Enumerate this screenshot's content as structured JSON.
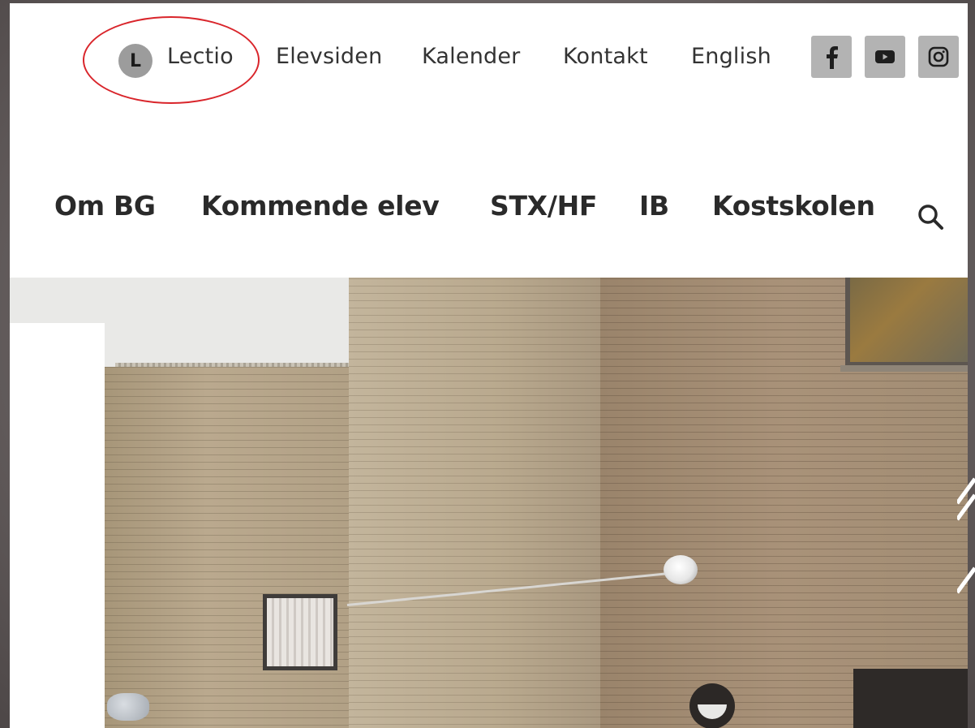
{
  "topbar": {
    "lectio_badge": "L",
    "links": {
      "lectio": "Lectio",
      "elevsiden": "Elevsiden",
      "kalender": "Kalender",
      "kontakt": "Kontakt",
      "english": "English"
    },
    "social": {
      "facebook_icon": "facebook-icon",
      "youtube_icon": "youtube-icon",
      "instagram_icon": "instagram-icon"
    }
  },
  "mainnav": {
    "items": [
      {
        "label": "Om BG"
      },
      {
        "label": "Kommende elev"
      },
      {
        "label": "STX/HF"
      },
      {
        "label": "IB"
      },
      {
        "label": "Kostskolen"
      }
    ],
    "search_icon": "search-icon"
  },
  "colors": {
    "highlight": "#d9252b",
    "social_bg": "#b3b3b3",
    "text": "#333333"
  }
}
